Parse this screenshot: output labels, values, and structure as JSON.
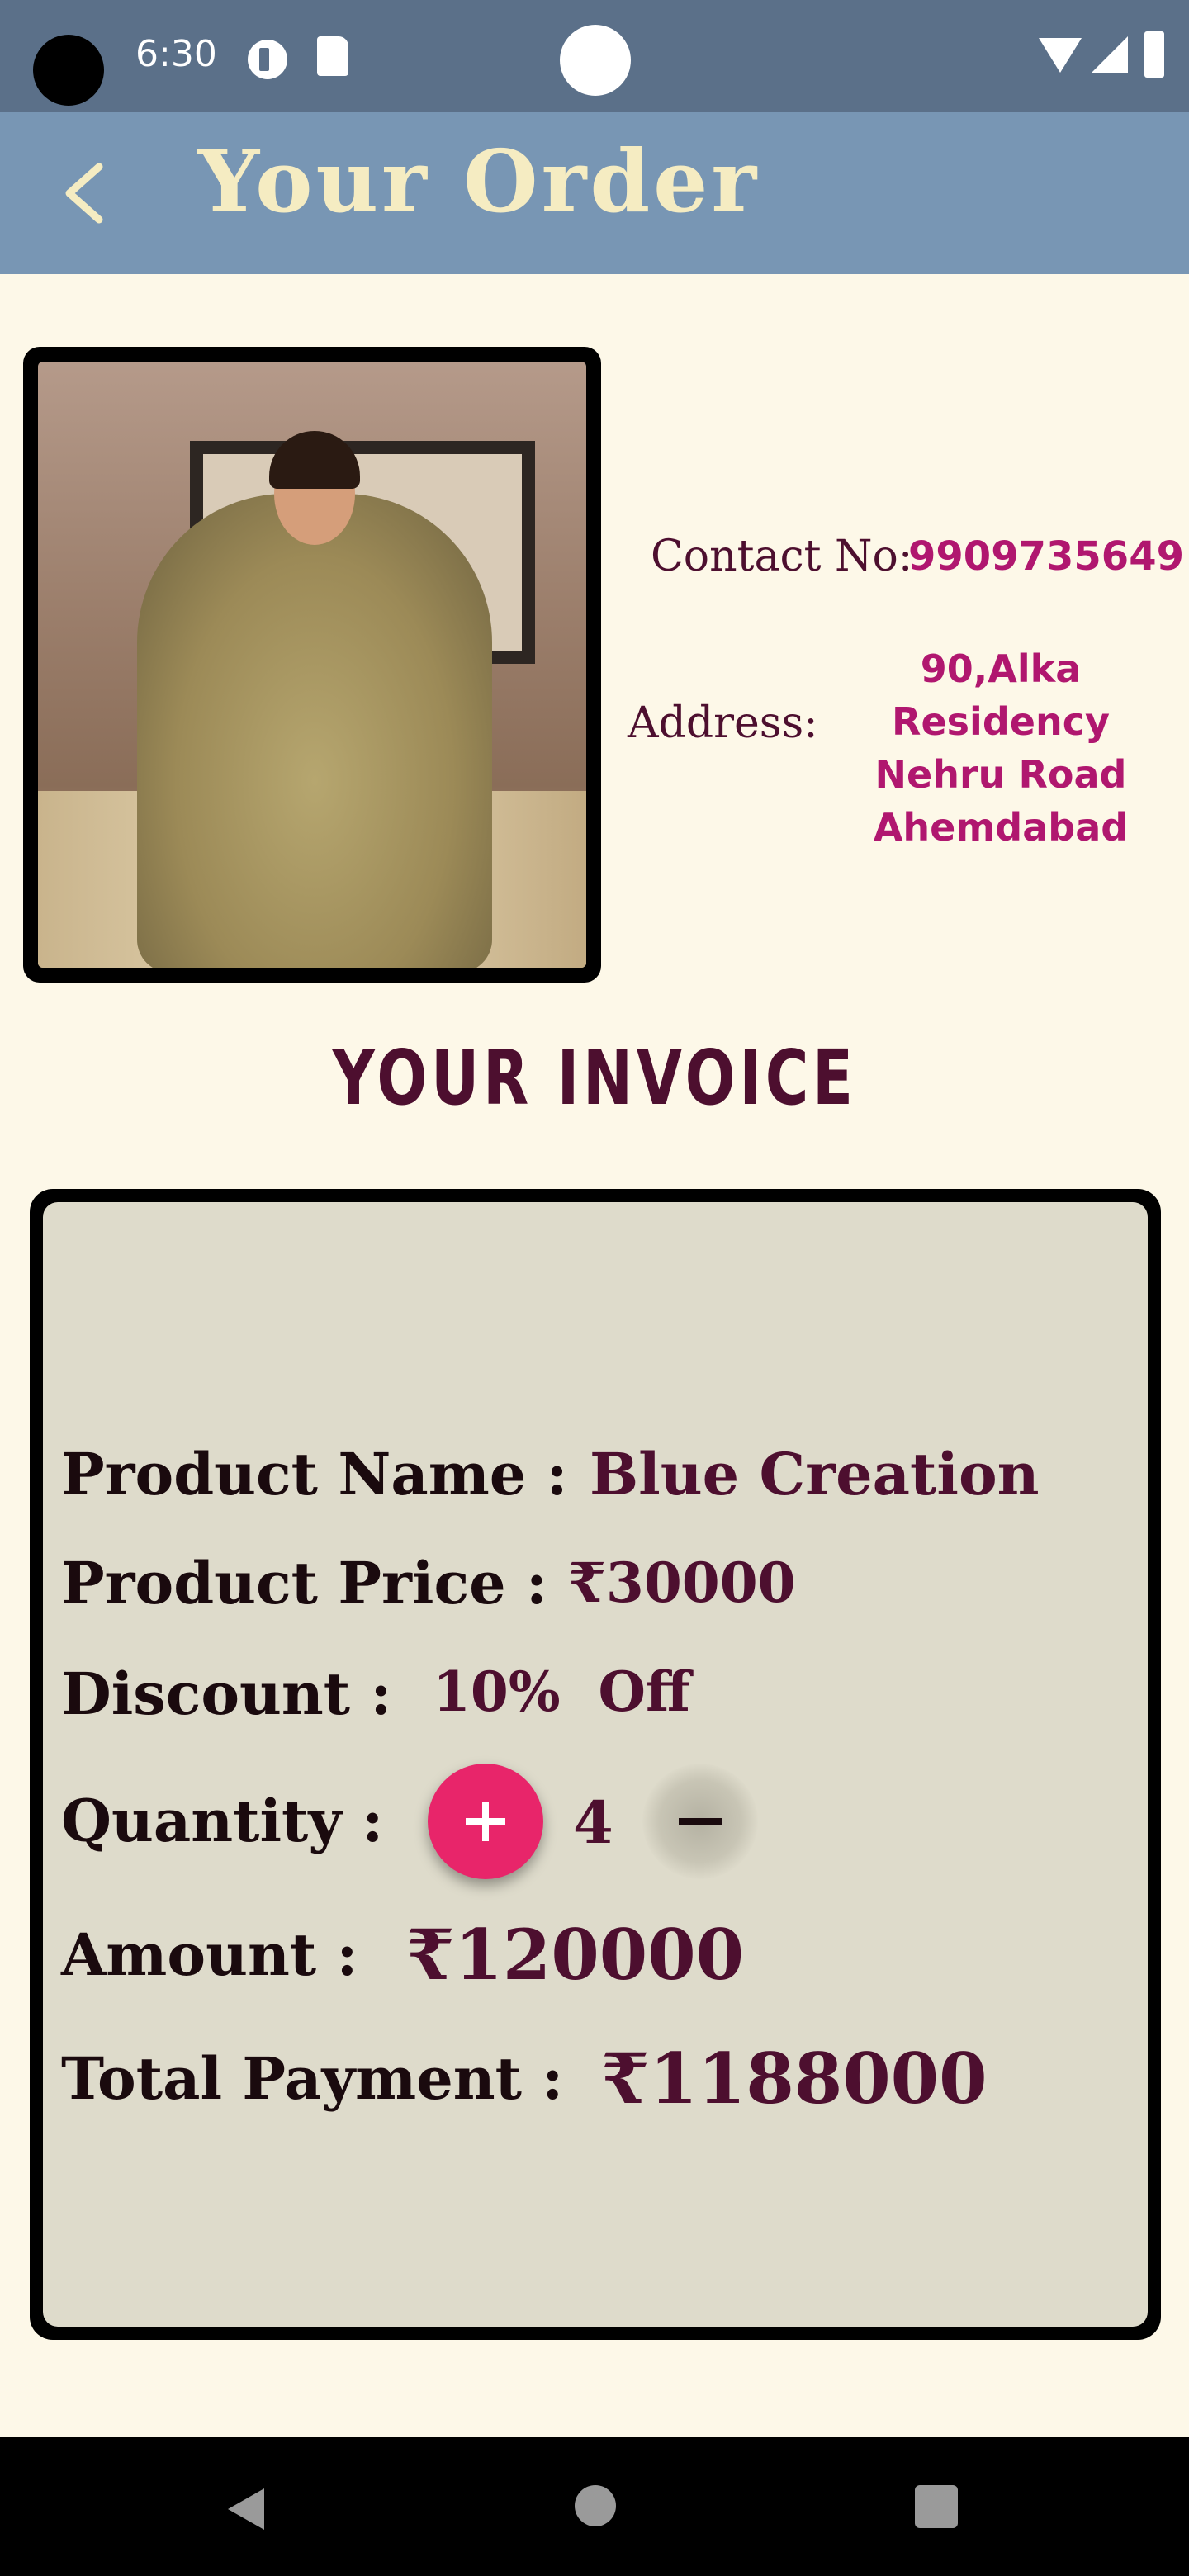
{
  "status_bar": {
    "time": "6:30",
    "icons": [
      "data-saver-icon",
      "sd-card-icon",
      "wifi-icon",
      "signal-icon",
      "battery-icon"
    ]
  },
  "app_bar": {
    "title": "Your Order",
    "back_icon": "chevron-left-icon"
  },
  "contact": {
    "label": "Contact No:",
    "value": "9909735649"
  },
  "address": {
    "label": "Address:",
    "lines": [
      "90,Alka Residency",
      "Nehru Road",
      "Ahemdabad"
    ]
  },
  "invoice": {
    "heading": "YOUR INVOICE",
    "product_name_label": "Product Name :",
    "product_name_value": "Blue Creation",
    "product_price_label": "Product Price :",
    "product_price_value": "₹30000",
    "discount_label": "Discount :",
    "discount_value": "10%  Off",
    "quantity_label": "Quantity :",
    "quantity_value": "4",
    "plus_symbol": "+",
    "minus_symbol": "−",
    "amount_label": "Amount :",
    "amount_value": "₹120000",
    "total_label": "Total Payment :",
    "total_value": "₹1188000"
  },
  "nav_bar": {
    "icons": [
      "back-triangle-icon",
      "home-circle-icon",
      "recents-square-icon"
    ]
  },
  "colors": {
    "status_bar": "#5b7089",
    "app_bar": "#7896b4",
    "title_text": "#f5ecc2",
    "background": "#fdf8e8",
    "card": "#dedbcb",
    "accent_text": "#4d0f2f",
    "link_text": "#b0176f",
    "plus_button": "#e8256a"
  }
}
